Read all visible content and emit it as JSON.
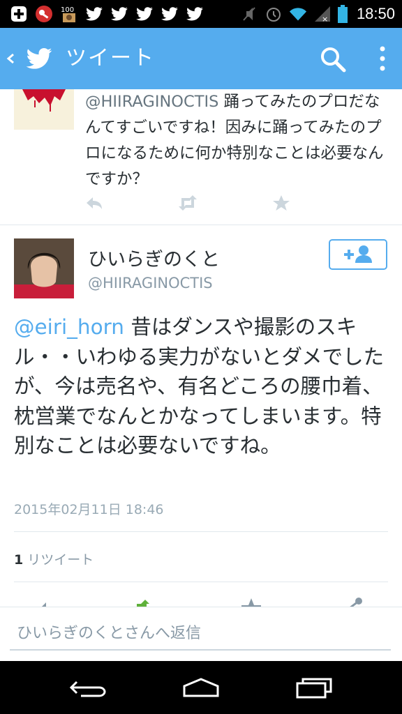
{
  "status_bar": {
    "time": "18:50",
    "left_icons": [
      "add-icon",
      "security-icon",
      "100-badge-icon",
      "twitter-icon",
      "twitter-icon",
      "twitter-icon",
      "twitter-icon",
      "twitter-icon"
    ],
    "right_icons": [
      "mute-icon",
      "alarm-icon",
      "wifi-icon",
      "signal-icon",
      "battery-icon"
    ]
  },
  "app_bar": {
    "title": "ツイート",
    "color": "#55acee"
  },
  "previous_tweet": {
    "handle": "@HIIRAGINOCTIS",
    "text": " 踊ってみたのプロだなんてすごいですね！因みに踊ってみたのプロになるために何か特別なことは必要なんですか？"
  },
  "tweet": {
    "name": "ひいらぎのくと",
    "screen_name": "@HIIRAGINOCTIS",
    "mention": "@eiri_horn",
    "text": " 昔はダンスや撮影のスキル・・いわゆる実力がないとダメでしたが、今は売名や、有名どころの腰巾着、枕営業でなんとかなってしまいます。特別なことは必要ないですね。",
    "timestamp": "2015年02月11日 18:46",
    "retweet_count": "1",
    "retweet_label": "リツイート"
  },
  "reply_bar": {
    "placeholder": "ひいらぎのくとさんへ返信"
  },
  "nav_bar": {
    "buttons": [
      "back-icon",
      "home-icon",
      "recents-icon"
    ]
  }
}
